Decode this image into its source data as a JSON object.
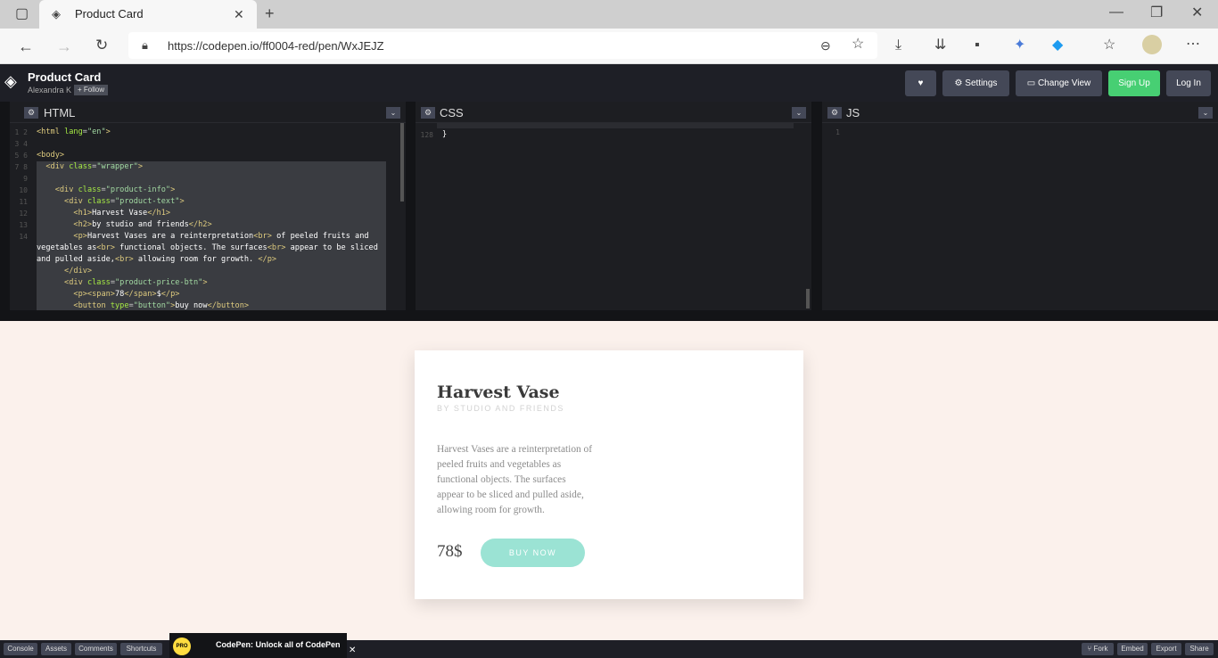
{
  "browser": {
    "tab_title": "Product Card",
    "url": "https://codepen.io/ff0004-red/pen/WxJEJZ"
  },
  "codepen": {
    "title": "Product Card",
    "author": "Alexandra K",
    "follow": "+ Follow",
    "settings": "Settings",
    "change_view": "Change View",
    "sign_up": "Sign Up",
    "log_in": "Log In"
  },
  "editors": {
    "html_label": "HTML",
    "css_label": "CSS",
    "js_label": "JS"
  },
  "product": {
    "title": "Harvest Vase",
    "subtitle": "BY STUDIO AND FRIENDS",
    "description": "Harvest Vases are a reinterpretation of peeled fruits and vegetables as functional objects. The surfaces appear to be sliced and pulled aside, allowing room for growth.",
    "price": "78$",
    "button": "BUY NOW"
  },
  "bottom": {
    "console": "Console",
    "assets": "Assets",
    "comments": "Comments",
    "shortcuts": "Shortcuts",
    "promo": "CodePen: Unlock all of CodePen",
    "fork": "Fork",
    "embed": "Embed",
    "export": "Export",
    "share": "Share"
  },
  "colors": {
    "accent_green": "#47cf73",
    "buy_button": "#9be3d4",
    "preview_bg": "#fbf1ec"
  }
}
